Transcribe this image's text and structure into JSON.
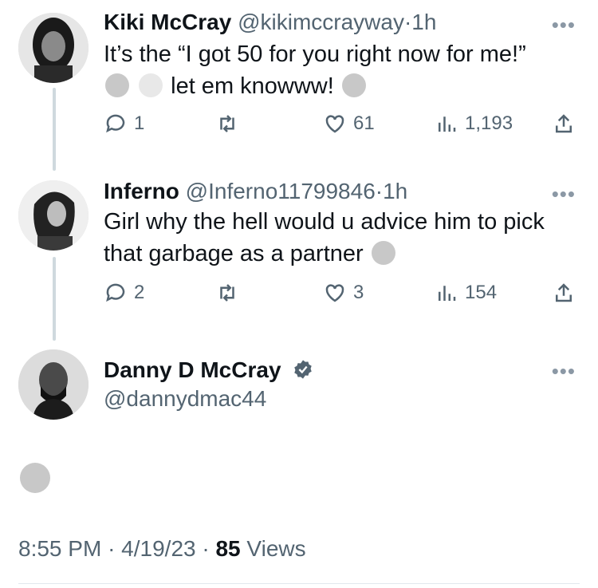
{
  "tweets": [
    {
      "name": "Kiki McCray",
      "handle": "@kikimccrayway",
      "time": "1h",
      "line1": "It’s the “I got 50 for you right now for me!”",
      "line2": "let em knowww!",
      "replies": "1",
      "retweets": "",
      "likes": "61",
      "views": "1,193",
      "emojis": [
        "joy-emoji",
        "skull-emoji",
        "face-hand-over-mouth-emoji"
      ]
    },
    {
      "name": "Inferno",
      "handle": "@Inferno11799846",
      "time": "1h",
      "line1": "Girl why the hell would u advice him to pick",
      "line2": "that garbage as a partner",
      "replies": "2",
      "retweets": "",
      "likes": "3",
      "views": "154",
      "emojis": [
        "screaming-emoji"
      ]
    }
  ],
  "main_tweet": {
    "name": "Danny D McCray",
    "handle": "@dannydmac44",
    "verified": true,
    "emoji": "joy-emoji",
    "time": "8:55 PM",
    "date": "4/19/23",
    "views_count": "85",
    "views_label": "Views"
  },
  "separator": "·",
  "colors": {
    "text": "#0f1419",
    "secondary": "#536471",
    "thread_line": "#cfd9de"
  }
}
